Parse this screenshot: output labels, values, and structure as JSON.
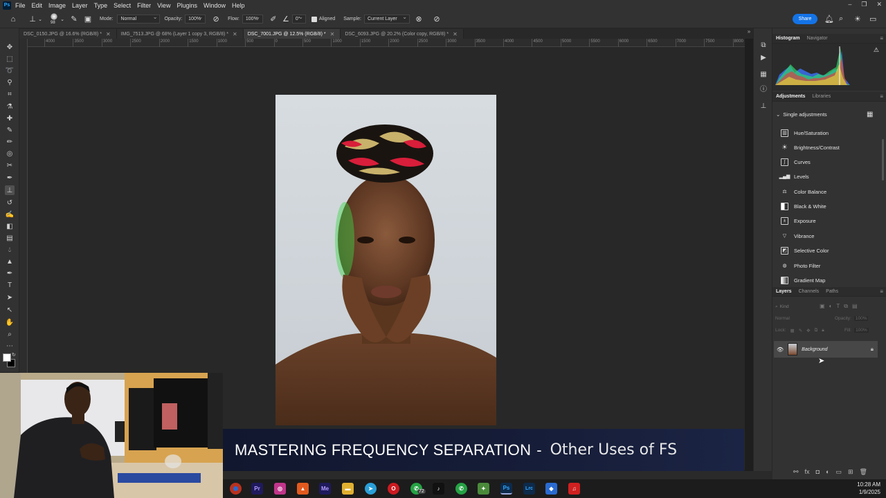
{
  "app": {
    "logo": "Ps"
  },
  "menubar": {
    "items": [
      "File",
      "Edit",
      "Image",
      "Layer",
      "Type",
      "Select",
      "Filter",
      "View",
      "Plugins",
      "Window",
      "Help"
    ]
  },
  "options": {
    "brush_size": "98",
    "mode_label": "Mode:",
    "mode_value": "Normal",
    "opacity_label": "Opacity:",
    "opacity_value": "100%",
    "flow_label": "Flow:",
    "flow_value": "100%",
    "angle_value": "0°",
    "aligned_label": "Aligned",
    "sample_label": "Sample:",
    "sample_value": "Current Layer",
    "share_label": "Share"
  },
  "tabs": [
    {
      "label": "DSC_0150.JPG @ 16.6% (RGB/8) *"
    },
    {
      "label": "IMG_7513.JPG @ 68% (Layer 1 copy 3, RGB/8) *"
    },
    {
      "label": "DSC_7001.JPG @ 12.5% (RGB/8) *"
    },
    {
      "label": "DSC_6093.JPG @ 20.2% (Color copy, RGB/8) *"
    }
  ],
  "ruler_top": [
    "4000",
    "3500",
    "3000",
    "2500",
    "2000",
    "1500",
    "1000",
    "500",
    "0",
    "500",
    "1000",
    "1500",
    "2000",
    "2500",
    "3000",
    "3500",
    "4000",
    "4500",
    "5000",
    "5500",
    "6000",
    "6500",
    "7000",
    "7500",
    "8000"
  ],
  "panels": {
    "top_tabs": [
      "Histogram",
      "Navigator"
    ],
    "adj_tabs": [
      "Adjustments",
      "Libraries"
    ],
    "single_adjustments": "Single adjustments",
    "adjustments": [
      {
        "label": "Hue/Saturation",
        "icon": "hue-saturation-icon"
      },
      {
        "label": "Brightness/Contrast",
        "icon": "brightness-icon"
      },
      {
        "label": "Curves",
        "icon": "curves-icon"
      },
      {
        "label": "Levels",
        "icon": "levels-icon"
      },
      {
        "label": "Color Balance",
        "icon": "color-balance-icon"
      },
      {
        "label": "Black & White",
        "icon": "black-white-icon"
      },
      {
        "label": "Exposure",
        "icon": "exposure-icon"
      },
      {
        "label": "Vibrance",
        "icon": "vibrance-icon"
      },
      {
        "label": "Selective Color",
        "icon": "selective-color-icon"
      },
      {
        "label": "Photo Filter",
        "icon": "photo-filter-icon"
      },
      {
        "label": "Gradient Map",
        "icon": "gradient-map-icon"
      }
    ],
    "layers_tabs": [
      "Layers",
      "Channels",
      "Paths"
    ],
    "layers_kind": "Kind",
    "layers_blend": "Normal",
    "layers_opacity_label": "Opacity:",
    "layers_opacity_value": "100%",
    "layers_lock_label": "Lock:",
    "layers_fill_label": "Fill:",
    "layers_fill_value": "100%",
    "layer_name": "Background"
  },
  "banner": {
    "main": "MASTERING FREQUENCY SEPARATION",
    "sep": "-",
    "sub": "Other Uses of FS"
  },
  "taskbar": {
    "apps": [
      {
        "name": "chrome",
        "label": "",
        "color": "#b8321f"
      },
      {
        "name": "premiere",
        "label": "Pr",
        "color": "#1f1a5c"
      },
      {
        "name": "instagram",
        "label": "◎",
        "color": "#c1358a"
      },
      {
        "name": "brave",
        "label": "▲",
        "color": "#e25a1f"
      },
      {
        "name": "media-encoder",
        "label": "Me",
        "color": "#1f1a5c"
      },
      {
        "name": "file-explorer",
        "label": "▬",
        "color": "#e0b030"
      },
      {
        "name": "telegram",
        "label": "➤",
        "color": "#2a9fd8"
      },
      {
        "name": "opera",
        "label": "O",
        "color": "#cc1a20"
      },
      {
        "name": "whatsapp",
        "label": "✆",
        "color": "#25a244"
      },
      {
        "name": "tiktok",
        "label": "♪",
        "color": "#111111"
      },
      {
        "name": "whatsapp-business",
        "label": "✆",
        "color": "#25a244"
      },
      {
        "name": "app-green",
        "label": "✦",
        "color": "#4a8a3a"
      },
      {
        "name": "photoshop",
        "label": "Ps",
        "color": "#0d2a4a"
      },
      {
        "name": "lightroom",
        "label": "Lrc",
        "color": "#0d2a4a"
      },
      {
        "name": "app-blue",
        "label": "◆",
        "color": "#2a6ad0"
      },
      {
        "name": "acrobat",
        "label": "♫",
        "color": "#d02020"
      }
    ],
    "badge": "72",
    "time": "10:28 AM",
    "date": "1/9/2025"
  },
  "colors": {
    "accent": "#1473e6",
    "banner_bg": "#161d38"
  }
}
